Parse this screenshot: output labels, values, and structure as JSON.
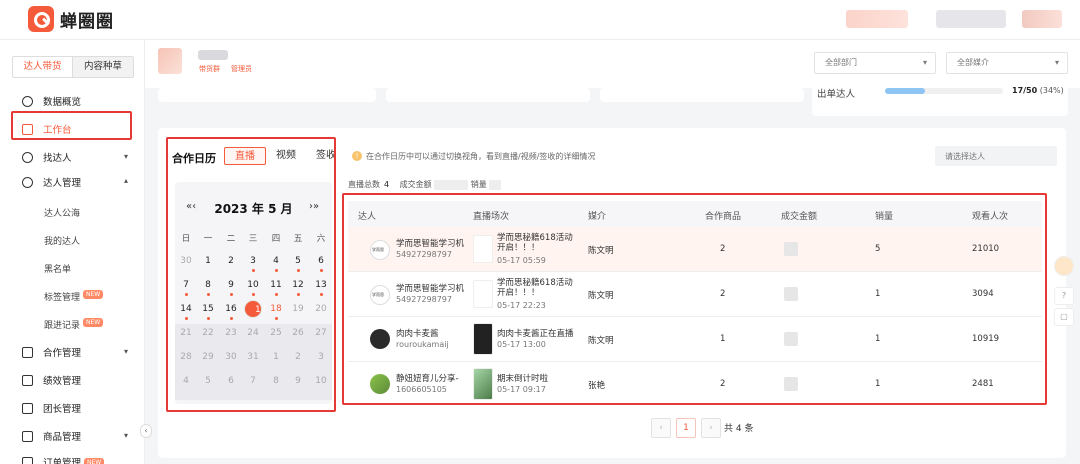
{
  "app": {
    "title": "蝉圈圈"
  },
  "sidebar": {
    "modes": [
      "达人带货",
      "内容种草"
    ],
    "items": [
      {
        "label": "数据概览"
      },
      {
        "label": "工作台"
      },
      {
        "label": "找达人"
      },
      {
        "label": "达人管理"
      },
      {
        "label": "合作管理"
      },
      {
        "label": "绩效管理"
      },
      {
        "label": "团长管理"
      },
      {
        "label": "商品管理"
      },
      {
        "label": "订单管理"
      }
    ],
    "subitems": [
      "达人公海",
      "我的达人",
      "黑名单",
      "标签管理",
      "跟进记录"
    ],
    "new_badge": "NEW"
  },
  "header": {
    "tags": [
      "带货群",
      "管理员"
    ],
    "filters": [
      "全部部门",
      "全部媒介"
    ]
  },
  "progress": {
    "label": "出单达人",
    "value_text": "17/50",
    "percent_text": "(34%)",
    "fraction": 0.34
  },
  "calendar": {
    "title": "合作日历",
    "tabs": [
      "直播",
      "视频",
      "签收"
    ],
    "active_tab": "直播",
    "nav_prev": "«‹",
    "nav_next": "›»",
    "month_label": "2023 年  5 月",
    "weekdays": [
      "日",
      "一",
      "二",
      "三",
      "四",
      "五",
      "六"
    ],
    "weeks": [
      [
        "30",
        "1",
        "2",
        "3",
        "4",
        "5",
        "6"
      ],
      [
        "7",
        "8",
        "9",
        "10",
        "11",
        "12",
        "13"
      ],
      [
        "14",
        "15",
        "16",
        "17",
        "18",
        "19",
        "20"
      ],
      [
        "21",
        "22",
        "23",
        "24",
        "25",
        "26",
        "27"
      ],
      [
        "28",
        "29",
        "30",
        "31",
        "1",
        "2",
        "3"
      ],
      [
        "4",
        "5",
        "6",
        "7",
        "8",
        "9",
        "10"
      ]
    ],
    "selected_day": "17"
  },
  "hint": {
    "icon": "!",
    "text": "在合作日历中可以通过切换视角，看到直播/视频/签收的详细情况"
  },
  "search": {
    "placeholder": "请选择达人"
  },
  "stats": {
    "live_total_label": "直播总数",
    "live_total": "4",
    "deal_label": "成交金额",
    "sales_label": "销量"
  },
  "table": {
    "columns": [
      "达人",
      "直播场次",
      "媒介",
      "合作商品",
      "成交金额",
      "销量",
      "观看人次"
    ],
    "rows": [
      {
        "name": "学而思智能学习机",
        "id": "54927298797",
        "live_title": "学而思秘籍618活动开启！！！",
        "live_time": "05-17 05:59",
        "agent": "陈文明",
        "products": "2",
        "sales": "5",
        "views": "21010"
      },
      {
        "name": "学而思智能学习机",
        "id": "54927298797",
        "live_title": "学而思秘籍618活动开启！！！",
        "live_time": "05-17 22:23",
        "agent": "陈文明",
        "products": "2",
        "sales": "1",
        "views": "3094"
      },
      {
        "name": "肉肉卡麦酱",
        "id": "rouroukamaij",
        "live_title": "肉肉卡麦酱正在直播",
        "live_time": "05-17 13:00",
        "agent": "陈文明",
        "products": "1",
        "sales": "1",
        "views": "10919"
      },
      {
        "name": "静妞妞育儿分享-",
        "id": "1606605105",
        "live_title": "期末倒计时啦",
        "live_time": "05-17 09:17",
        "agent": "张艳",
        "products": "2",
        "sales": "1",
        "views": "2481"
      }
    ]
  },
  "pagination": {
    "prev": "‹",
    "current": "1",
    "next": "›",
    "total": "共 4 条"
  },
  "colors": {
    "accent": "#f55b3a",
    "highlight_box": "#e53935"
  }
}
